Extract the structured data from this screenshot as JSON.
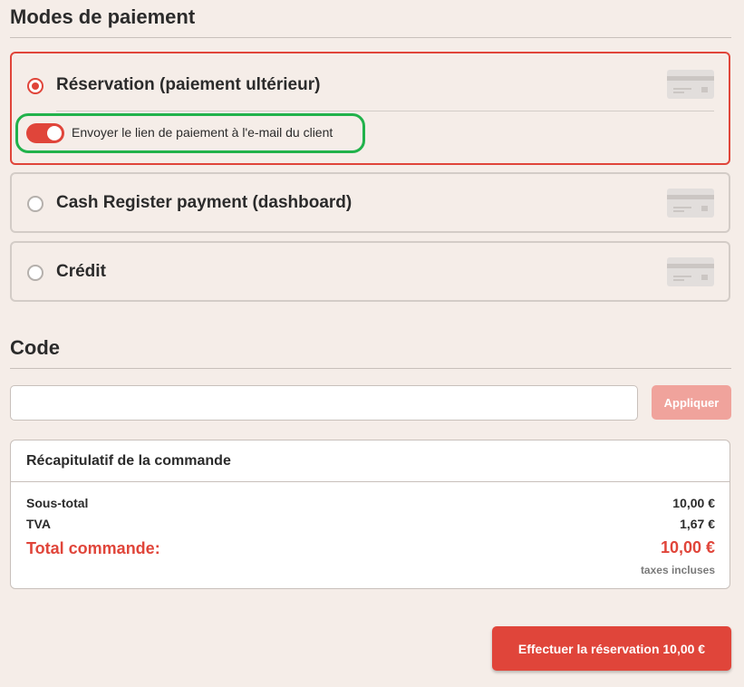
{
  "payment": {
    "title": "Modes de paiement",
    "options": [
      {
        "label": "Réservation (paiement ultérieur)",
        "selected": true,
        "icon": "credit-card-icon"
      },
      {
        "label": "Cash Register payment (dashboard)",
        "selected": false,
        "icon": "credit-card-icon"
      },
      {
        "label": "Crédit",
        "selected": false,
        "icon": "credit-card-icon"
      }
    ],
    "toggle": {
      "label": "Envoyer le lien de paiement à l'e-mail du client",
      "on": true
    }
  },
  "code": {
    "title": "Code",
    "input_value": "",
    "apply_label": "Appliquer"
  },
  "summary": {
    "title": "Récapitulatif de la commande",
    "rows": [
      {
        "label": "Sous-total",
        "value": "10,00 €"
      },
      {
        "label": "TVA",
        "value": "1,67 €"
      }
    ],
    "total_label": "Total commande:",
    "total_value": "10,00 €",
    "tax_note": "taxes incluses"
  },
  "submit_label": "Effectuer la réservation 10,00 €",
  "colors": {
    "accent": "#e0453a",
    "highlight": "#21b24b",
    "background": "#f5ede8"
  }
}
